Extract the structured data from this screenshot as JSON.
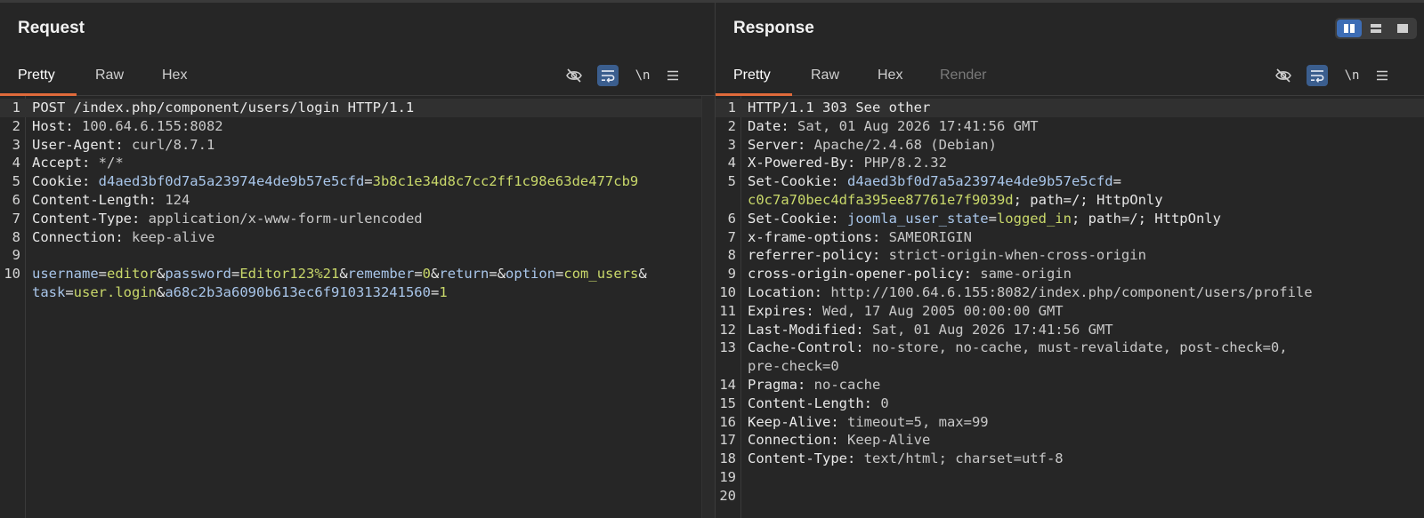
{
  "request": {
    "title": "Request",
    "tabs": [
      "Pretty",
      "Raw",
      "Hex"
    ],
    "active_tab": "Pretty",
    "newline_label": "\\n",
    "lines": [
      {
        "n": "1",
        "parts": [
          [
            "k",
            "POST /index.php/component/users/login HTTP/1.1"
          ]
        ]
      },
      {
        "n": "2",
        "parts": [
          [
            "k",
            "Host: "
          ],
          [
            "v",
            "100.64.6.155:8082"
          ]
        ]
      },
      {
        "n": "3",
        "parts": [
          [
            "k",
            "User-Agent: "
          ],
          [
            "v",
            "curl/8.7.1"
          ]
        ]
      },
      {
        "n": "4",
        "parts": [
          [
            "k",
            "Accept: "
          ],
          [
            "v",
            "*/*"
          ]
        ]
      },
      {
        "n": "5",
        "parts": [
          [
            "k",
            "Cookie: "
          ],
          [
            "n",
            "d4aed3bf0d7a5a23974e4de9b57e5cfd"
          ],
          [
            "p",
            "="
          ],
          [
            "s",
            "3b8c1e34d8c7cc2ff1c98e63de477cb9"
          ]
        ]
      },
      {
        "n": "6",
        "parts": [
          [
            "k",
            "Content-Length: "
          ],
          [
            "v",
            "124"
          ]
        ]
      },
      {
        "n": "7",
        "parts": [
          [
            "k",
            "Content-Type: "
          ],
          [
            "v",
            "application/x-www-form-urlencoded"
          ]
        ]
      },
      {
        "n": "8",
        "parts": [
          [
            "k",
            "Connection: "
          ],
          [
            "v",
            "keep-alive"
          ]
        ]
      },
      {
        "n": "9",
        "parts": []
      },
      {
        "n": "10",
        "parts": [
          [
            "n",
            "username"
          ],
          [
            "p",
            "="
          ],
          [
            "s",
            "editor"
          ],
          [
            "p",
            "&"
          ],
          [
            "n",
            "password"
          ],
          [
            "p",
            "="
          ],
          [
            "s",
            "Editor123%21"
          ],
          [
            "p",
            "&"
          ],
          [
            "n",
            "remember"
          ],
          [
            "p",
            "="
          ],
          [
            "s",
            "0"
          ],
          [
            "p",
            "&"
          ],
          [
            "n",
            "return"
          ],
          [
            "p",
            "=&"
          ],
          [
            "n",
            "option"
          ],
          [
            "p",
            "="
          ],
          [
            "s",
            "com_users"
          ],
          [
            "p",
            "&"
          ]
        ]
      },
      {
        "n": "",
        "parts": [
          [
            "n",
            "task"
          ],
          [
            "p",
            "="
          ],
          [
            "s",
            "user.login"
          ],
          [
            "p",
            "&"
          ],
          [
            "n",
            "a68c2b3a6090b613ec6f910313241560"
          ],
          [
            "p",
            "="
          ],
          [
            "s",
            "1"
          ]
        ]
      }
    ]
  },
  "response": {
    "title": "Response",
    "tabs": [
      "Pretty",
      "Raw",
      "Hex",
      "Render"
    ],
    "active_tab": "Pretty",
    "newline_label": "\\n",
    "lines": [
      {
        "n": "1",
        "parts": [
          [
            "k",
            "HTTP/1.1 303 See other"
          ]
        ]
      },
      {
        "n": "2",
        "parts": [
          [
            "k",
            "Date: "
          ],
          [
            "v",
            "Sat, 01 Aug 2026 17:41:56 GMT"
          ]
        ]
      },
      {
        "n": "3",
        "parts": [
          [
            "k",
            "Server: "
          ],
          [
            "v",
            "Apache/2.4.68 (Debian)"
          ]
        ]
      },
      {
        "n": "4",
        "parts": [
          [
            "k",
            "X-Powered-By: "
          ],
          [
            "v",
            "PHP/8.2.32"
          ]
        ]
      },
      {
        "n": "5",
        "parts": [
          [
            "k",
            "Set-Cookie: "
          ],
          [
            "n",
            "d4aed3bf0d7a5a23974e4de9b57e5cfd"
          ],
          [
            "p",
            "="
          ]
        ]
      },
      {
        "n": "",
        "parts": [
          [
            "s",
            "c0c7a70bec4dfa395ee87761e7f9039d"
          ],
          [
            "p",
            "; path=/; HttpOnly"
          ]
        ]
      },
      {
        "n": "6",
        "parts": [
          [
            "k",
            "Set-Cookie: "
          ],
          [
            "n",
            "joomla_user_state"
          ],
          [
            "p",
            "="
          ],
          [
            "s",
            "logged_in"
          ],
          [
            "p",
            "; path=/; HttpOnly"
          ]
        ]
      },
      {
        "n": "7",
        "parts": [
          [
            "k",
            "x-frame-options: "
          ],
          [
            "v",
            "SAMEORIGIN"
          ]
        ]
      },
      {
        "n": "8",
        "parts": [
          [
            "k",
            "referrer-policy: "
          ],
          [
            "v",
            "strict-origin-when-cross-origin"
          ]
        ]
      },
      {
        "n": "9",
        "parts": [
          [
            "k",
            "cross-origin-opener-policy: "
          ],
          [
            "v",
            "same-origin"
          ]
        ]
      },
      {
        "n": "10",
        "parts": [
          [
            "k",
            "Location: "
          ],
          [
            "v",
            "http://100.64.6.155:8082/index.php/component/users/profile"
          ]
        ]
      },
      {
        "n": "11",
        "parts": [
          [
            "k",
            "Expires: "
          ],
          [
            "v",
            "Wed, 17 Aug 2005 00:00:00 GMT"
          ]
        ]
      },
      {
        "n": "12",
        "parts": [
          [
            "k",
            "Last-Modified: "
          ],
          [
            "v",
            "Sat, 01 Aug 2026 17:41:56 GMT"
          ]
        ]
      },
      {
        "n": "13",
        "parts": [
          [
            "k",
            "Cache-Control: "
          ],
          [
            "v",
            "no-store, no-cache, must-revalidate, post-check=0,"
          ]
        ]
      },
      {
        "n": "",
        "parts": [
          [
            "v",
            "pre-check=0"
          ]
        ]
      },
      {
        "n": "14",
        "parts": [
          [
            "k",
            "Pragma: "
          ],
          [
            "v",
            "no-cache"
          ]
        ]
      },
      {
        "n": "15",
        "parts": [
          [
            "k",
            "Content-Length: "
          ],
          [
            "v",
            "0"
          ]
        ]
      },
      {
        "n": "16",
        "parts": [
          [
            "k",
            "Keep-Alive: "
          ],
          [
            "v",
            "timeout=5, max=99"
          ]
        ]
      },
      {
        "n": "17",
        "parts": [
          [
            "k",
            "Connection: "
          ],
          [
            "v",
            "Keep-Alive"
          ]
        ]
      },
      {
        "n": "18",
        "parts": [
          [
            "k",
            "Content-Type: "
          ],
          [
            "v",
            "text/html; charset=utf-8"
          ]
        ]
      },
      {
        "n": "19",
        "parts": []
      },
      {
        "n": "20",
        "parts": []
      }
    ]
  },
  "icons": {
    "hide_nonprintable": "eye-slash-icon",
    "wrap": "wrap-lines-icon",
    "menu": "hamburger-menu-icon",
    "layout": [
      "columns-layout-icon",
      "rows-layout-icon",
      "single-pane-icon"
    ]
  },
  "colors": {
    "accent_tab": "#e06a3b",
    "toggle_on": "#3b5e8e",
    "header_name": "#a9c6ea",
    "value_string": "#c9d86a"
  }
}
